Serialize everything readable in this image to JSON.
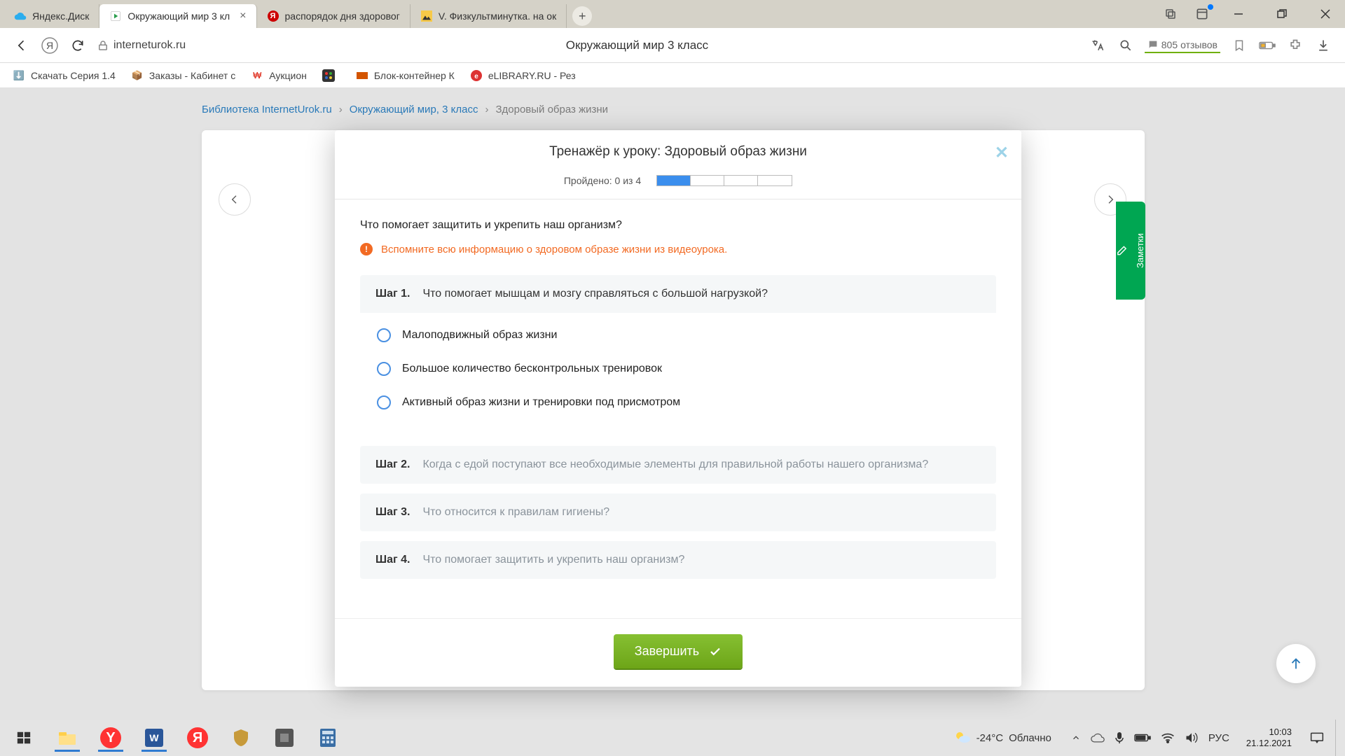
{
  "tabs": [
    {
      "label": "Яндекс.Диск",
      "favicon_fill": "#2badee"
    },
    {
      "label": "Окружающий мир 3 кл",
      "favicon_fill": "#ffcc00",
      "active": true
    },
    {
      "label": "распорядок дня здоровог",
      "favicon_fill": "#ff3333"
    },
    {
      "label": "V. Физкультминутка. на ок",
      "favicon_fill": "#f7c948"
    }
  ],
  "addr": {
    "url": "interneturok.ru"
  },
  "page_title": "Окружающий мир 3 класс",
  "reviews": {
    "count": "805",
    "label": "отзывов"
  },
  "bookmarks": [
    {
      "label": "Скачать Серия 1.4"
    },
    {
      "label": "Заказы - Кабинет с"
    },
    {
      "label": "Аукцион"
    },
    {
      "label": ""
    },
    {
      "label": "Блок-контейнер К"
    },
    {
      "label": "eLIBRARY.RU - Рез"
    }
  ],
  "breadcrumbs": {
    "root": "Библиотека InternetUrok.ru",
    "section": "Окружающий мир, 3 класс",
    "current": "Здоровый образ жизни"
  },
  "notes_tab": "Заметки",
  "modal": {
    "title": "Тренажёр к уроку: Здоровый образ жизни",
    "progress_label": "Пройдено: 0 из 4",
    "segments": 4,
    "filled": 1,
    "question": "Что помогает защитить и укрепить наш организм?",
    "hint": "Вспомните всю информацию о здоровом образе жизни из видеоурока.",
    "steps": [
      {
        "label": "Шаг 1.",
        "q": "Что помогает мышцам и мозгу справляться с большой нагрузкой?",
        "active": true,
        "options": [
          "Малоподвижный образ жизни",
          "Большое количество бесконтрольных тренировок",
          "Активный образ жизни и тренировки под присмотром"
        ]
      },
      {
        "label": "Шаг 2.",
        "q": "Когда с едой поступают все необходимые элементы для правильной работы нашего организма?",
        "active": false
      },
      {
        "label": "Шаг 3.",
        "q": "Что относится к правилам гигиены?",
        "active": false
      },
      {
        "label": "Шаг 4.",
        "q": "Что помогает защитить и укрепить наш организм?",
        "active": false
      }
    ],
    "finish": "Завершить"
  },
  "weather": {
    "temp": "-24°C",
    "desc": "Облачно"
  },
  "tray": {
    "lang": "РУС"
  },
  "clock": {
    "time": "10:03",
    "date": "21.12.2021"
  }
}
